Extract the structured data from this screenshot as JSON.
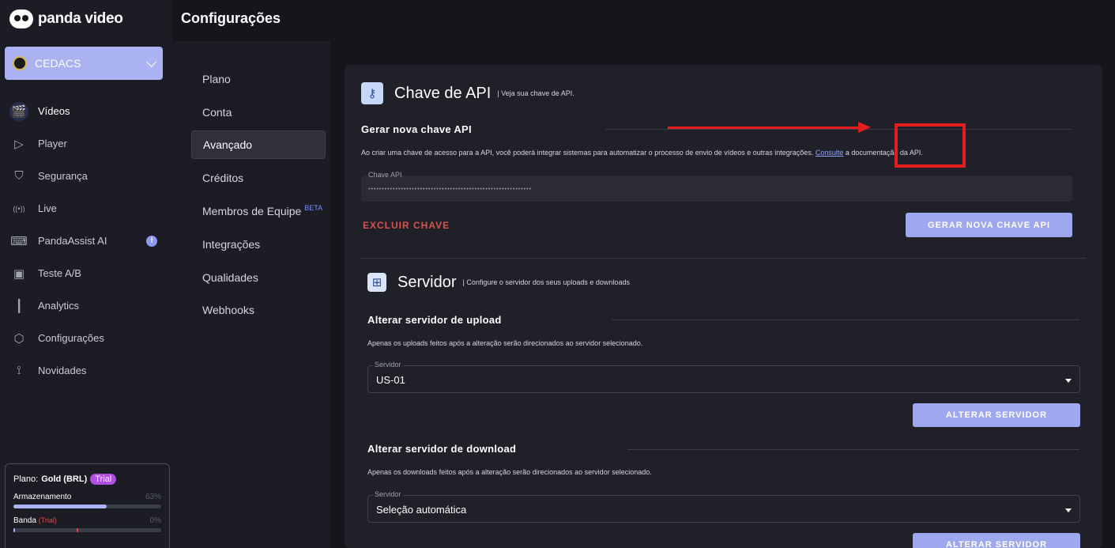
{
  "app": {
    "logo_text": "panda video",
    "page_title": "Configurações"
  },
  "account": {
    "name": "CEDACS"
  },
  "nav": [
    {
      "label": "Vídeos",
      "icon": "clapperboard-icon",
      "glyph": "🎬"
    },
    {
      "label": "Player",
      "icon": "play-circle-icon",
      "glyph": "▷"
    },
    {
      "label": "Segurança",
      "icon": "shield-icon",
      "glyph": "⛉"
    },
    {
      "label": "Live",
      "icon": "broadcast-icon",
      "glyph": "((•))"
    },
    {
      "label": "PandaAssist AI",
      "icon": "chat-bot-icon",
      "glyph": "⌨",
      "badge": "!"
    },
    {
      "label": "Teste A/B",
      "icon": "ab-test-icon",
      "glyph": "▣"
    },
    {
      "label": "Analytics",
      "icon": "bar-chart-icon",
      "glyph": "┃"
    },
    {
      "label": "Configurações",
      "icon": "settings-icon",
      "glyph": "⬡"
    },
    {
      "label": "Novidades",
      "icon": "rss-icon",
      "glyph": "⟟"
    }
  ],
  "plan": {
    "label": "Plano:",
    "name": "Gold (BRL)",
    "trial": "Trial",
    "storage_label": "Armazenamento",
    "storage_pct": "63%",
    "storage_fill": 0.63,
    "band_label": "Banda",
    "band_trial": "(Trial)",
    "band_pct": "0%",
    "band_fill": 0.01
  },
  "submenu": {
    "items": [
      "Plano",
      "Conta",
      "Avançado",
      "Créditos",
      "Membros de Equipe",
      "Integrações",
      "Qualidades",
      "Webhooks"
    ],
    "beta_label": "BETA"
  },
  "api": {
    "title": "Chave de API",
    "subtitle": "| Veja sua chave de API.",
    "section_head": "Gerar nova chave API",
    "desc_before": "Ao criar uma chave de acesso para a API, você poderá integrar sistemas para automatizar o processo de envio de vídeos e outras integrações. ",
    "desc_link": "Consulte",
    "desc_after": " a documentação da API.",
    "field_label": "Chave API",
    "field_value": "••••••••••••••••••••••••••••••••••••••••••••••••••••••••••••",
    "delete_label": "EXCLUIR CHAVE",
    "generate_label": "GERAR NOVA CHAVE API"
  },
  "server": {
    "title": "Servidor",
    "subtitle": "| Configure o servidor dos seus uploads e downloads",
    "upload_head": "Alterar servidor de upload",
    "upload_desc": "Apenas os uploads feitos após a alteração serão direcionados ao servidor selecionado.",
    "upload_field_label": "Servidor",
    "upload_value": "US-01",
    "upload_button": "ALTERAR SERVIDOR",
    "download_head": "Alterar servidor de download",
    "download_desc": "Apenas os downloads feitos após a alteração serão direcionados ao servidor selecionado.",
    "download_field_label": "Servidor",
    "download_value": "Seleção automática",
    "download_button": "ALTERAR SERVIDOR"
  },
  "colors": {
    "accent": "#aab2f2",
    "button": "#9ea8ee",
    "danger": "#d9534f",
    "annotation": "#e51c1c"
  }
}
